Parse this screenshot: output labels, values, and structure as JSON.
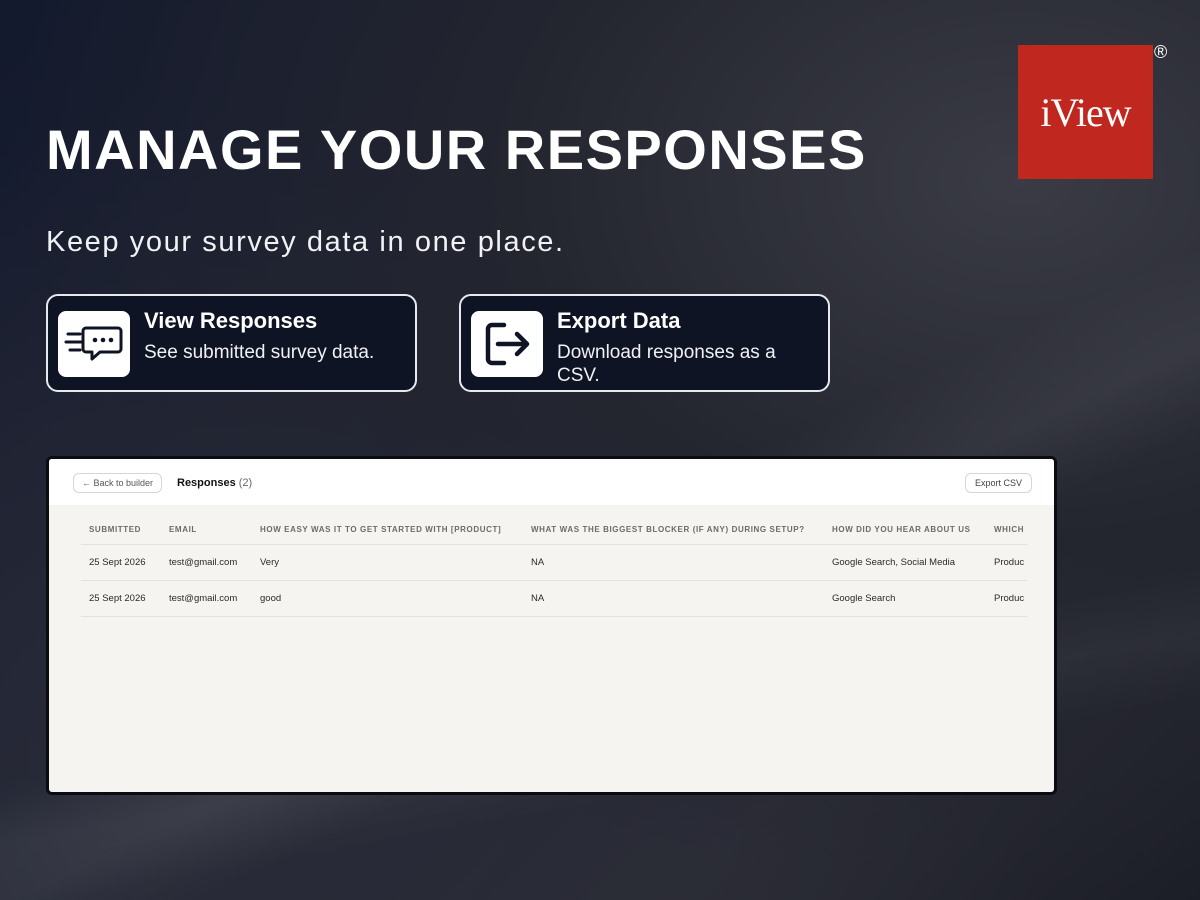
{
  "hero": {
    "title": "MANAGE YOUR RESPONSES",
    "subtitle": "Keep your survey data in one place."
  },
  "brand": {
    "logo_text": "iView",
    "registered": "®",
    "color": "#c0271e"
  },
  "features": [
    {
      "icon": "chat-lines-icon",
      "title": "View Responses",
      "desc": "See submitted survey data."
    },
    {
      "icon": "export-arrow-icon",
      "title": "Export Data",
      "desc": "Download responses as a CSV."
    }
  ],
  "app": {
    "back_label": "← Back to builder",
    "responses_label": "Responses",
    "responses_count": "(2)",
    "export_label": "Export CSV",
    "columns": [
      "SUBMITTED",
      "EMAIL",
      "HOW EASY WAS IT TO GET STARTED WITH [PRODUCT]",
      "WHAT WAS THE BIGGEST BLOCKER (IF ANY) DURING SETUP?",
      "HOW DID YOU HEAR ABOUT US",
      "WHICH"
    ],
    "rows": [
      [
        "25 Sept 2026",
        "test@gmail.com",
        "Very",
        "NA",
        "Google Search, Social Media",
        "Produc"
      ],
      [
        "25 Sept 2026",
        "test@gmail.com",
        "good",
        "NA",
        "Google Search",
        "Produc"
      ]
    ]
  }
}
